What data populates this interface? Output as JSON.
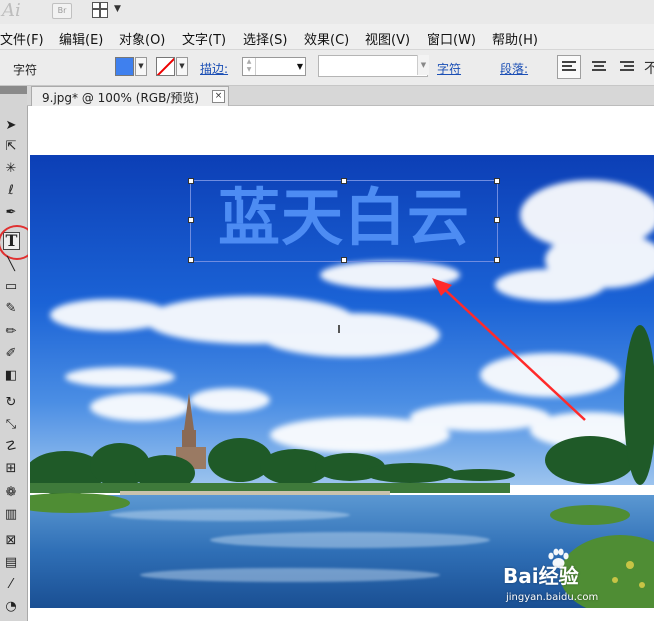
{
  "app": {
    "logo": "Ai",
    "bridge_label": "Br"
  },
  "menu": [
    "文件(F)",
    "编辑(E)",
    "对象(O)",
    "文字(T)",
    "选择(S)",
    "效果(C)",
    "视图(V)",
    "窗口(W)",
    "帮助(H)"
  ],
  "control_bar": {
    "mode_label": "字符",
    "fill_color": "#3f80ee",
    "stroke_label": "描边:",
    "stroke_value": "",
    "character_link": "字符",
    "paragraph_link": "段落:",
    "partial_glyph": "不"
  },
  "tools": [
    "selection-tool",
    "direct-selection-tool",
    "magic-wand-tool",
    "lasso-tool",
    "pen-tool",
    "type-tool",
    "line-tool",
    "rectangle-tool",
    "paintbrush-tool",
    "pencil-tool",
    "eraser-tool",
    "rotate-tool",
    "scale-tool",
    "warp-tool",
    "free-transform-tool",
    "symbol-sprayer-tool",
    "column-graph-tool",
    "mesh-tool",
    "gradient-tool",
    "eyedropper-tool",
    "blend-tool"
  ],
  "document": {
    "tab_title": "9.jpg* @ 100% (RGB/预览)",
    "close_glyph": "×"
  },
  "canvas": {
    "headline": "蓝天白云",
    "headline_color": "#4d8cf3",
    "annotation_color": "#ff2a2a"
  },
  "watermark": {
    "brand": "Bai经验",
    "url": "jingyan.baidu.com"
  }
}
